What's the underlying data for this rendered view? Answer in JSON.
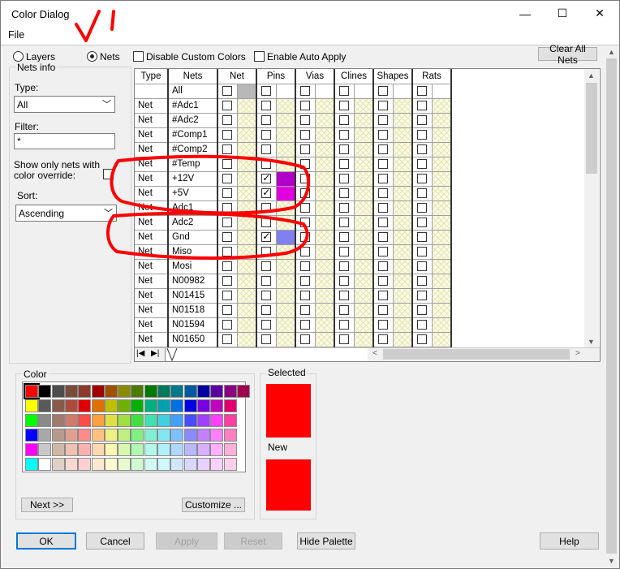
{
  "window": {
    "title": "Color Dialog",
    "minimize_glyph": "—",
    "maximize_glyph": "☐",
    "close_glyph": "✕"
  },
  "menu": {
    "file": "File"
  },
  "top": {
    "layers_label": "Layers",
    "nets_label": "Nets",
    "disable_custom_colors": "Disable Custom Colors",
    "enable_auto_apply": "Enable Auto Apply",
    "clear_all_nets": "Clear All Nets"
  },
  "nets_info": {
    "title": "Nets info",
    "type_label": "Type:",
    "type_value": "All",
    "filter_label": "Filter:",
    "filter_value": "*",
    "show_only_label_1": "Show only nets with",
    "show_only_label_2": "color override:",
    "sort_label": "Sort:",
    "sort_value": "Ascending"
  },
  "grid": {
    "headers": {
      "type": "Type",
      "nets": "Nets",
      "net": "Net",
      "pins": "Pins",
      "vias": "Vias",
      "clines": "Clines",
      "shapes": "Shapes",
      "rats": "Rats"
    },
    "rows": [
      {
        "type": "",
        "name": "All",
        "pins_checked": false,
        "color": ""
      },
      {
        "type": "Net",
        "name": "#Adc1",
        "pins_checked": false,
        "color": ""
      },
      {
        "type": "Net",
        "name": "#Adc2",
        "pins_checked": false,
        "color": ""
      },
      {
        "type": "Net",
        "name": "#Comp1",
        "pins_checked": false,
        "color": ""
      },
      {
        "type": "Net",
        "name": "#Comp2",
        "pins_checked": false,
        "color": ""
      },
      {
        "type": "Net",
        "name": "#Temp",
        "pins_checked": false,
        "color": ""
      },
      {
        "type": "Net",
        "name": "+12V",
        "pins_checked": true,
        "color": "#b000c8"
      },
      {
        "type": "Net",
        "name": "+5V",
        "pins_checked": true,
        "color": "#e000e0"
      },
      {
        "type": "Net",
        "name": "Adc1",
        "pins_checked": false,
        "color": ""
      },
      {
        "type": "Net",
        "name": "Adc2",
        "pins_checked": false,
        "color": ""
      },
      {
        "type": "Net",
        "name": "Gnd",
        "pins_checked": true,
        "color": "#8080f0"
      },
      {
        "type": "Net",
        "name": "Miso",
        "pins_checked": false,
        "color": ""
      },
      {
        "type": "Net",
        "name": "Mosi",
        "pins_checked": false,
        "color": ""
      },
      {
        "type": "Net",
        "name": "N00982",
        "pins_checked": false,
        "color": ""
      },
      {
        "type": "Net",
        "name": "N01415",
        "pins_checked": false,
        "color": ""
      },
      {
        "type": "Net",
        "name": "N01518",
        "pins_checked": false,
        "color": ""
      },
      {
        "type": "Net",
        "name": "N01594",
        "pins_checked": false,
        "color": ""
      },
      {
        "type": "Net",
        "name": "N01650",
        "pins_checked": false,
        "color": ""
      }
    ]
  },
  "color_panel": {
    "title": "Color",
    "next_button": "Next >>",
    "customize_button": "Customize ...",
    "palette": [
      [
        "#ff0000",
        "#000000",
        "#4d4d4d",
        "#7a4a3a",
        "#8b3a2a",
        "#a00000",
        "#a05000",
        "#8a8a00",
        "#4a7a00",
        "#007a00",
        "#007a5a",
        "#007a8a",
        "#005aa0",
        "#0000a0",
        "#5a00a0",
        "#8a0080",
        "#a00050"
      ],
      [
        "#ffff00",
        "#5a5a5a",
        "#8a5a4a",
        "#b04a3a",
        "#e00000",
        "#e07000",
        "#c0c000",
        "#70b000",
        "#00b000",
        "#00b080",
        "#00a0b0",
        "#0070e0",
        "#0000e0",
        "#7a00e0",
        "#c000c0",
        "#e00070"
      ],
      [
        "#00ff00",
        "#8a8a8a",
        "#a07a6a",
        "#d07a6a",
        "#ff4a4a",
        "#ffa040",
        "#e0e040",
        "#a0e040",
        "#40e040",
        "#40e0b0",
        "#40d0e0",
        "#40a0ff",
        "#4a4aff",
        "#a040ff",
        "#ff40ff",
        "#ff40a0"
      ],
      [
        "#0000ff",
        "#a8a8a8",
        "#b89a8a",
        "#e0a090",
        "#ff8a8a",
        "#ffc080",
        "#f0f080",
        "#c0f080",
        "#80f080",
        "#80f0d0",
        "#80e8f0",
        "#80c0ff",
        "#8a8aff",
        "#c080ff",
        "#ff80ff",
        "#ff80c0"
      ],
      [
        "#ff00ff",
        "#c8c8c8",
        "#d0b8a8",
        "#f0c0b0",
        "#ffb0b0",
        "#ffd8b0",
        "#f8f8b0",
        "#d8f8b0",
        "#b0f8b0",
        "#b0f8e8",
        "#b0f0f8",
        "#b0d8ff",
        "#b8b8ff",
        "#d8b0ff",
        "#ffb0ff",
        "#ffb0d8"
      ],
      [
        "#00ffff",
        "#ffffff",
        "#e0d0c8",
        "#f8d8d0",
        "#ffd0d0",
        "#ffe8d0",
        "#fbfbd0",
        "#e8fbd0",
        "#d0fbd0",
        "#d0fbf0",
        "#d0f8fb",
        "#d0e8ff",
        "#d8d8ff",
        "#e8d0ff",
        "#ffd0ff",
        "#ffd0e8"
      ]
    ]
  },
  "preview": {
    "selected_label": "Selected",
    "new_label": "New",
    "selected_color": "#ff0000",
    "new_color": "#ff0000"
  },
  "buttons": {
    "ok": "OK",
    "cancel": "Cancel",
    "apply": "Apply",
    "reset": "Reset",
    "hide_palette": "Hide Palette",
    "help": "Help"
  },
  "colors": {
    "annotation_red": "#ff0000"
  }
}
